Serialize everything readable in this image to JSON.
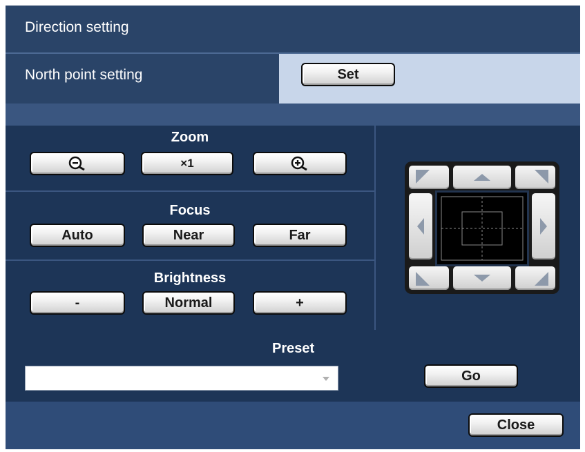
{
  "title": "Direction setting",
  "north": {
    "label": "North point setting",
    "set_button": "Set"
  },
  "zoom": {
    "label": "Zoom",
    "zoom_out_icon": "zoom-out-icon",
    "reset_label": "×1",
    "zoom_in_icon": "zoom-in-icon"
  },
  "focus": {
    "label": "Focus",
    "auto": "Auto",
    "near": "Near",
    "far": "Far"
  },
  "brightness": {
    "label": "Brightness",
    "minus": "-",
    "normal": "Normal",
    "plus": "+"
  },
  "preset": {
    "label": "Preset",
    "selected": "",
    "go": "Go"
  },
  "footer": {
    "close": "Close"
  },
  "colors": {
    "panel": "#2a4468",
    "dark": "#1d3557",
    "north_bg": "#c8d6ea"
  },
  "pad_icons": [
    "arrow-up-left-icon",
    "arrow-up-icon",
    "arrow-up-right-icon",
    "arrow-left-icon",
    "arrow-right-icon",
    "arrow-down-left-icon",
    "arrow-down-icon",
    "arrow-down-right-icon"
  ]
}
